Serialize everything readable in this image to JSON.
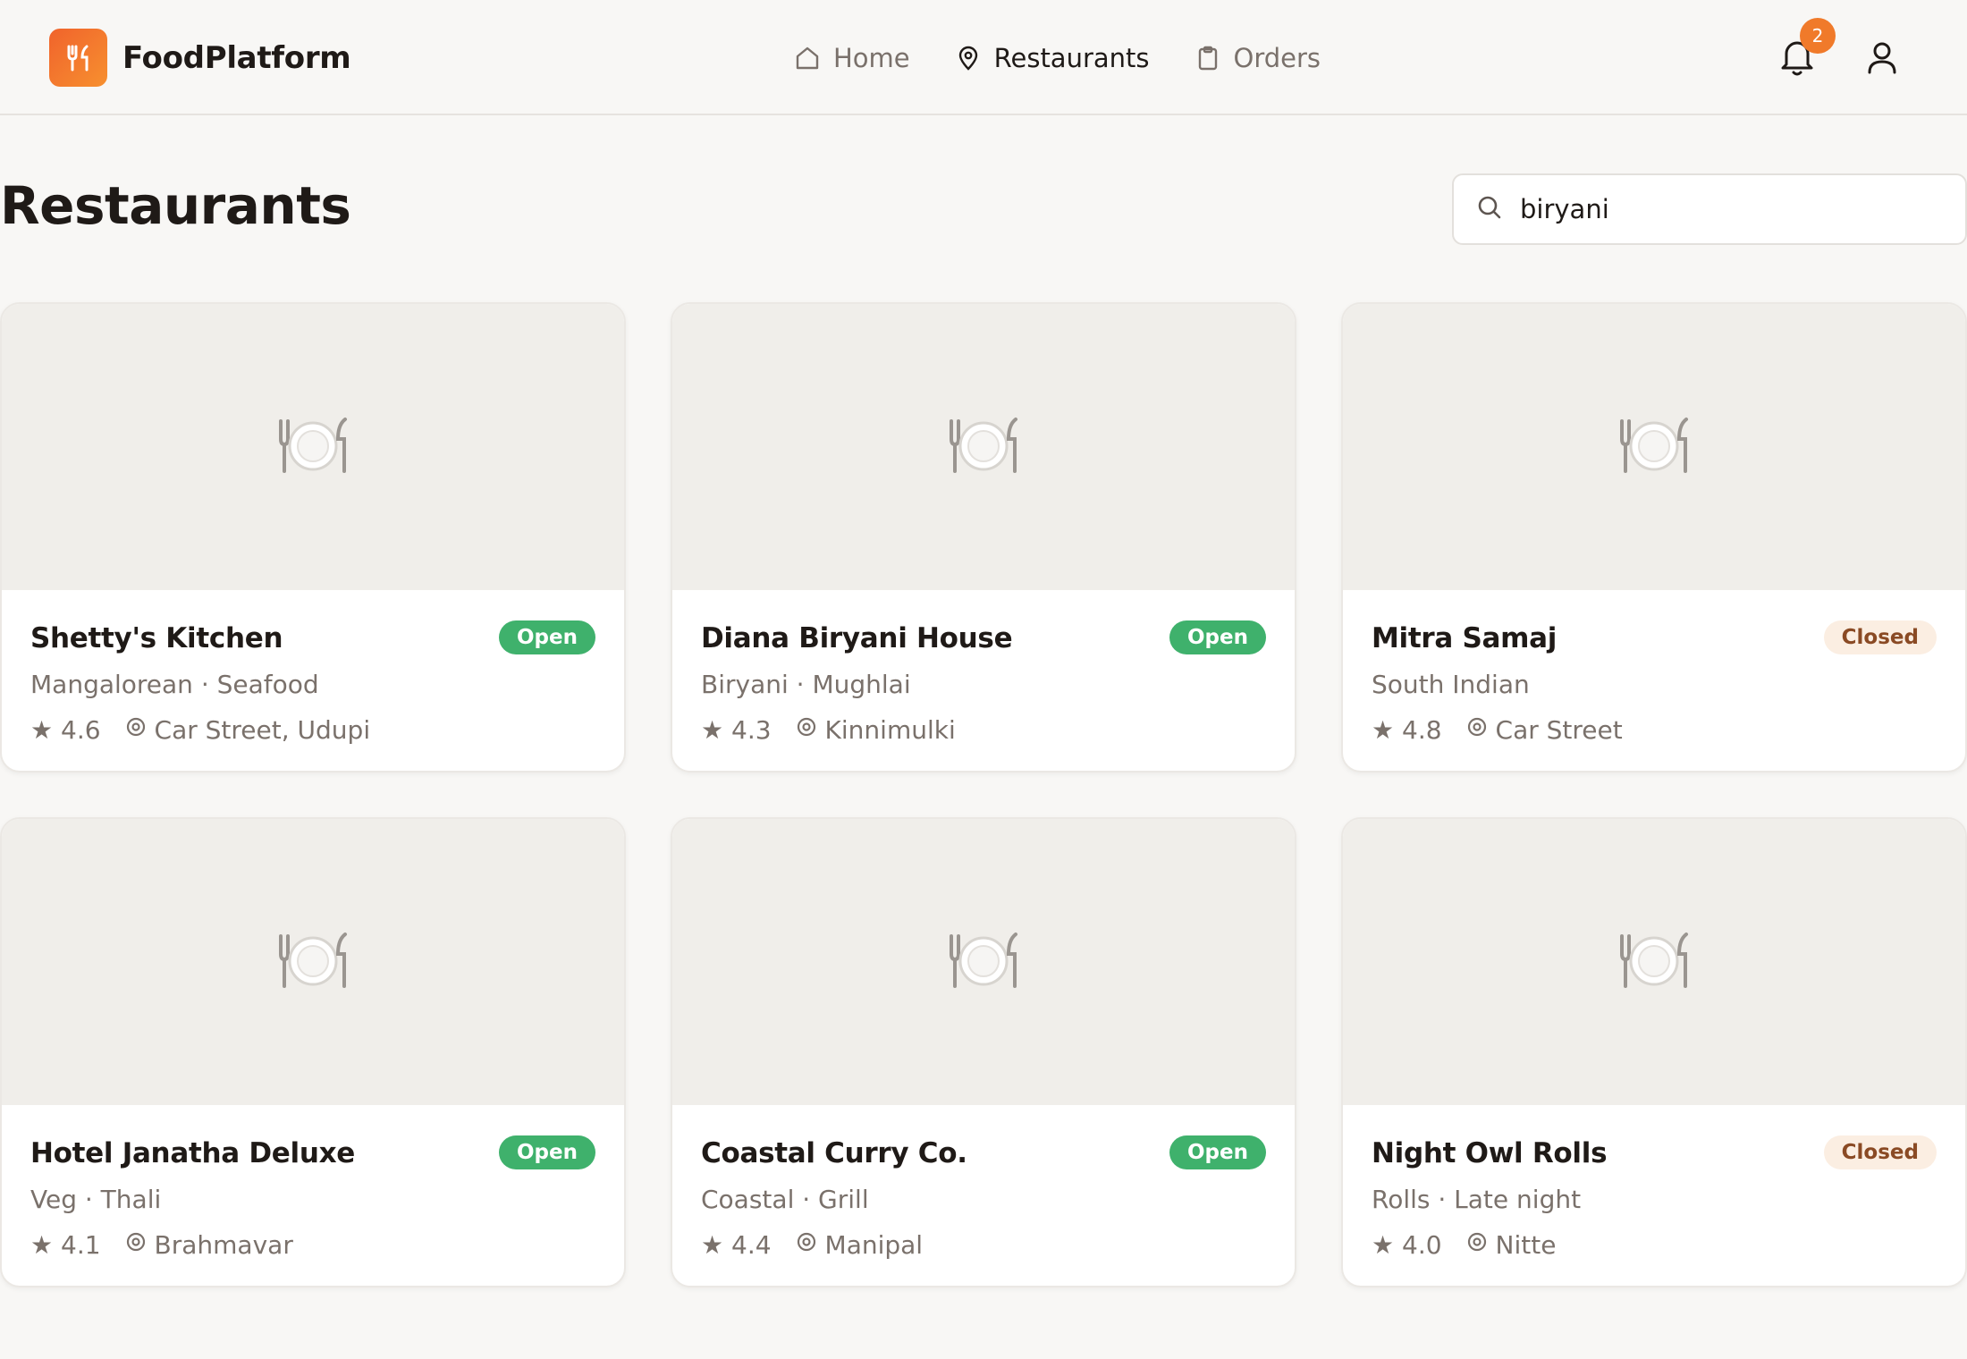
{
  "brand": {
    "name": "FoodPlatform",
    "logo_icon": "utensils-icon",
    "accent": "#f0632c"
  },
  "nav": {
    "items": [
      {
        "label": "Home",
        "icon": "home-icon",
        "active": false
      },
      {
        "label": "Restaurants",
        "icon": "map-pin-icon",
        "active": true
      },
      {
        "label": "Orders",
        "icon": "clipboard-icon",
        "active": false
      }
    ]
  },
  "header_actions": {
    "notification_count": "2"
  },
  "page": {
    "title": "Restaurants"
  },
  "search": {
    "value": "biryani"
  },
  "restaurants": [
    {
      "name": "Shetty's Kitchen",
      "status": "Open",
      "cuisine": "Mangalorean · Seafood",
      "rating": "★ 4.6",
      "location": "Car Street, Udupi"
    },
    {
      "name": "Diana Biryani House",
      "status": "Open",
      "cuisine": "Biryani · Mughlai",
      "rating": "★ 4.3",
      "location": "Kinnimulki"
    },
    {
      "name": "Mitra Samaj",
      "status": "Closed",
      "cuisine": "South Indian",
      "rating": "★ 4.8",
      "location": "Car Street"
    },
    {
      "name": "Hotel Janatha Deluxe",
      "status": "Open",
      "cuisine": "Veg · Thali",
      "rating": "★ 4.1",
      "location": "Brahmavar"
    },
    {
      "name": "Coastal Curry Co.",
      "status": "Open",
      "cuisine": "Coastal · Grill",
      "rating": "★ 4.4",
      "location": "Manipal"
    },
    {
      "name": "Night Owl Rolls",
      "status": "Closed",
      "cuisine": "Rolls · Late night",
      "rating": "★ 4.0",
      "location": "Nitte"
    }
  ],
  "colors": {
    "open": "#3fb16c",
    "closed_bg": "#fbeee2",
    "closed_text": "#8a4a24",
    "badge": "#f07a2a"
  }
}
